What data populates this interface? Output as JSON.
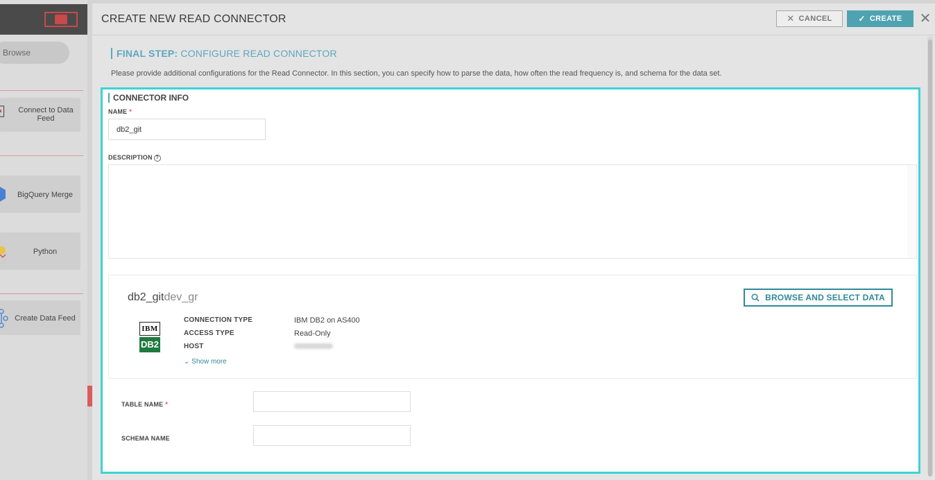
{
  "sidebar": {
    "browse_label": "Browse",
    "items": [
      {
        "label": "Connect to Data Feed",
        "icon": "document-icon"
      },
      {
        "label": "BigQuery Merge",
        "icon": "hexagon-icon"
      },
      {
        "label": "Python",
        "icon": "python-icon"
      },
      {
        "label": "Create Data Feed",
        "icon": "network-icon"
      }
    ]
  },
  "modal": {
    "title": "CREATE NEW READ CONNECTOR",
    "cancel_label": "CANCEL",
    "create_label": "CREATE",
    "close_symbol": "✕",
    "step_prefix": "FINAL STEP:",
    "step_title": " CONFIGURE READ CONNECTOR",
    "step_description": "Please provide additional configurations for the Read Connector. In this section, you can specify how to parse the data, how often the read frequency is, and schema for the data set."
  },
  "connector_info": {
    "section_title": "CONNECTOR INFO",
    "name_label": "NAME",
    "name_value": "db2_git",
    "description_label": "DESCRIPTION",
    "description_value": ""
  },
  "connection": {
    "name": "db2_git",
    "name_suffix": "dev_gr",
    "browse_label": "BROWSE AND SELECT DATA",
    "logo_top": "IBM",
    "logo_bottom": "DB2",
    "connection_type_label": "CONNECTION TYPE",
    "connection_type_value": "IBM DB2 on AS400",
    "access_type_label": "ACCESS TYPE",
    "access_type_value": "Read-Only",
    "host_label": "HOST",
    "show_more_label": "Show more"
  },
  "table": {
    "table_name_label": "TABLE NAME",
    "table_name_value": "",
    "schema_name_label": "SCHEMA NAME",
    "schema_name_value": ""
  },
  "colors": {
    "accent": "#4fa3b1",
    "highlight_border": "#3fd3d5",
    "required": "#d9534f",
    "ibm_db2_green": "#1f7a3f"
  }
}
